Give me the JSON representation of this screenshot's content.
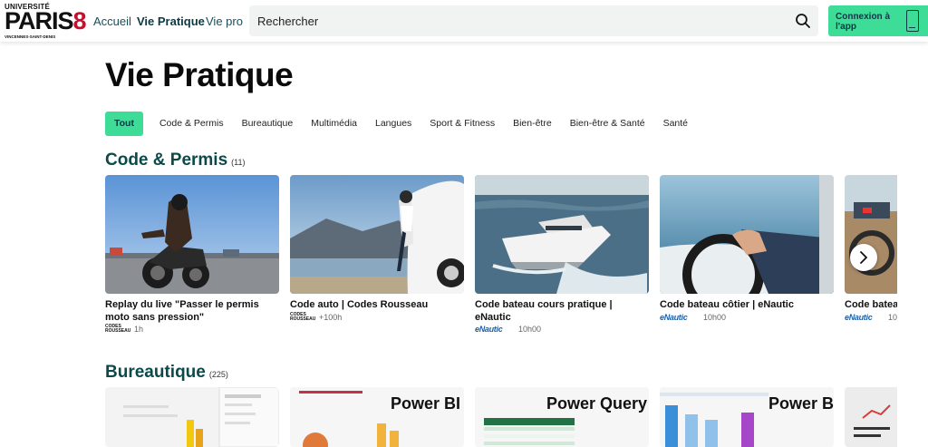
{
  "header": {
    "logo": {
      "line1": "UNIVERSITÉ",
      "paris": "PARIS",
      "eight": "8",
      "line3": "VINCENNES-SAINT-DENIS"
    },
    "nav": {
      "accueil": "Accueil",
      "vie_pratique": "Vie Pratique",
      "vie_pro": "Vie pro"
    },
    "search_placeholder": "Rechercher",
    "cta_label": "Connexion à l'app"
  },
  "page_title": "Vie Pratique",
  "filters": [
    "Tout",
    "Code & Permis",
    "Bureautique",
    "Multimédia",
    "Langues",
    "Sport & Fitness",
    "Bien-être",
    "Bien-être & Santé",
    "Santé"
  ],
  "sections": {
    "code": {
      "title": "Code & Permis",
      "count": "(11)",
      "cards": [
        {
          "title": "Replay du live \"Passer le permis moto sans pression\"",
          "provider": "CODES ROUSSEAU",
          "duration": "1h"
        },
        {
          "title": "Code auto | Codes Rousseau",
          "provider": "CODES ROUSSEAU",
          "duration": "+100h"
        },
        {
          "title": "Code bateau cours pratique | eNautic",
          "provider": "eNautic",
          "duration": "10h00"
        },
        {
          "title": "Code bateau côtier | eNautic",
          "provider": "eNautic",
          "duration": "10h00"
        },
        {
          "title": "Code bateau",
          "provider": "eNautic",
          "duration": "10"
        }
      ]
    },
    "bureautique": {
      "title": "Bureautique",
      "count": "(225)",
      "thumb_labels": [
        "Power BI",
        "Power Query",
        "Power B"
      ]
    }
  },
  "colors": {
    "accent": "#3ddc97",
    "section_title": "#0c4a4a",
    "nav": "#1a4d5c",
    "logo_red": "#c8102e"
  },
  "icons": {
    "search": "search-icon",
    "next": "chevron-right-icon",
    "cta": "phone-icon"
  }
}
